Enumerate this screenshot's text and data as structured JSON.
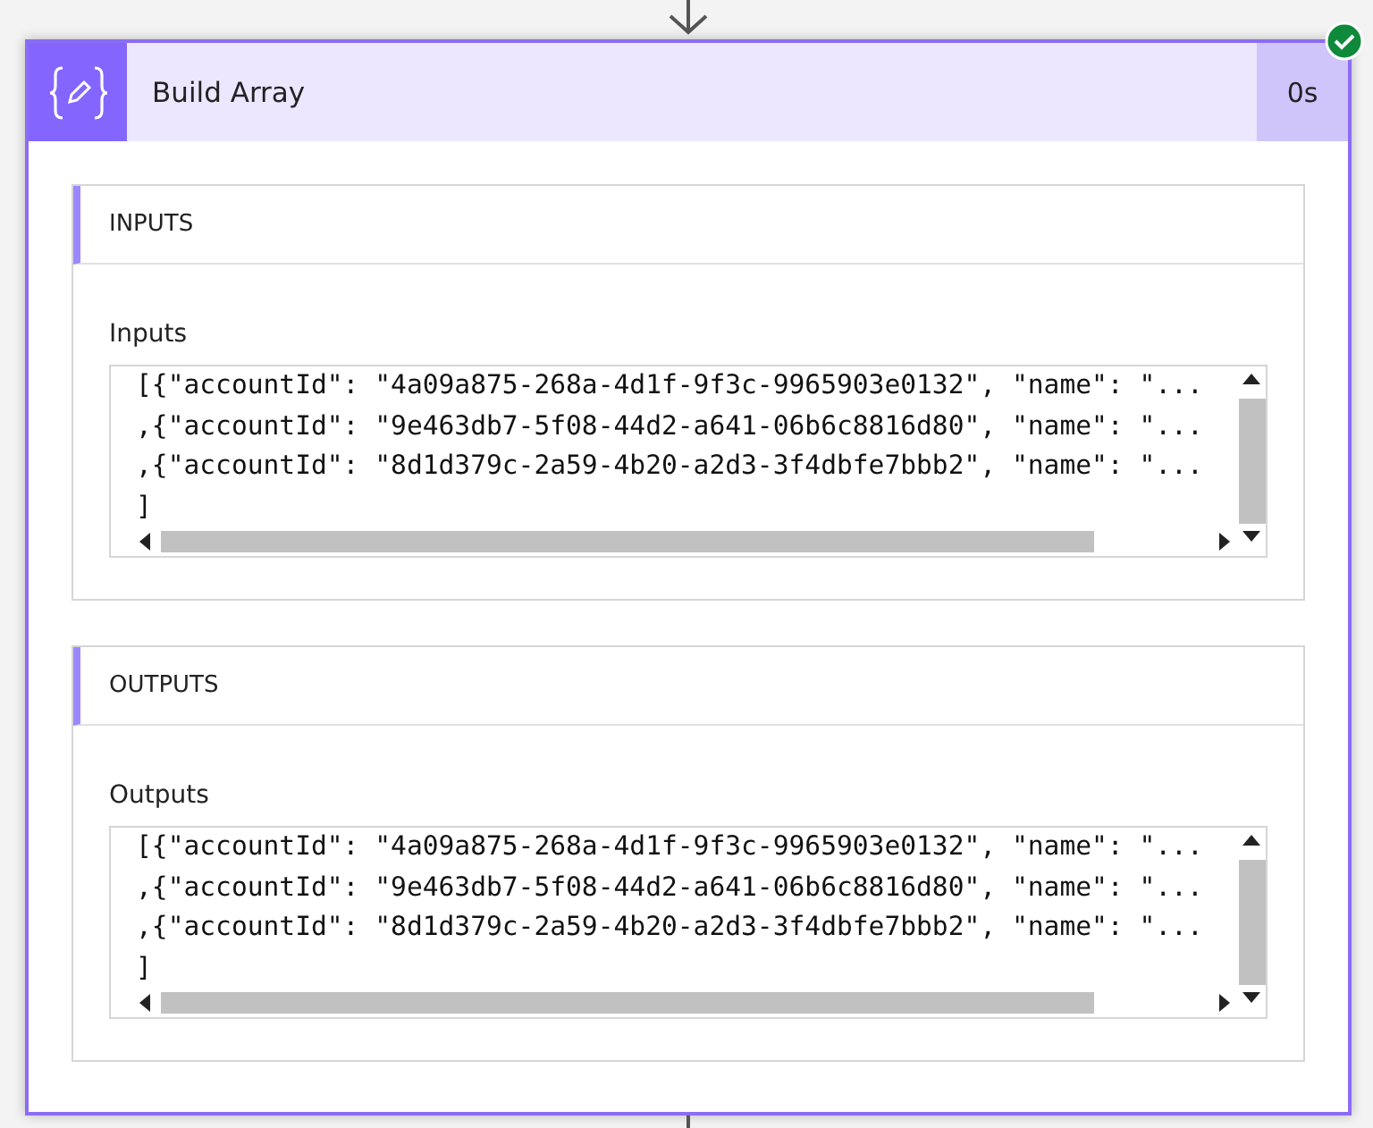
{
  "action": {
    "title": "Build Array",
    "duration": "0s",
    "succeeded": true
  },
  "sections": [
    {
      "heading": "INPUTS",
      "label": "Inputs",
      "lines": [
        "[{\"accountId\": \"4a09a875-268a-4d1f-9f3c-9965903e0132\", \"name\": \"...",
        ",{\"accountId\": \"9e463db7-5f08-44d2-a641-06b6c8816d80\", \"name\": \"...",
        ",{\"accountId\": \"8d1d379c-2a59-4b20-a2d3-3f4dbfe7bbb2\", \"name\": \"...",
        "]"
      ]
    },
    {
      "heading": "OUTPUTS",
      "label": "Outputs",
      "lines": [
        "[{\"accountId\": \"4a09a875-268a-4d1f-9f3c-9965903e0132\", \"name\": \"...",
        ",{\"accountId\": \"9e463db7-5f08-44d2-a641-06b6c8816d80\", \"name\": \"...",
        ",{\"accountId\": \"8d1d379c-2a59-4b20-a2d3-3f4dbfe7bbb2\", \"name\": \"...",
        "]"
      ]
    }
  ]
}
